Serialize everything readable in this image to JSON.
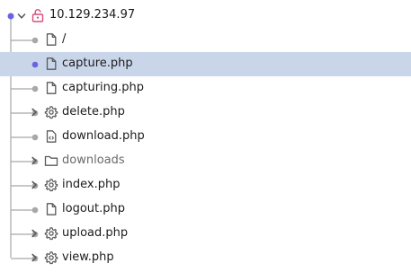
{
  "colors": {
    "selected_bg": "#c9d6ea",
    "root_lock": "#d94d7a",
    "active_dot": "#6b63e0",
    "tree_line": "#a8a8a8"
  },
  "root": {
    "label": "10.129.234.97",
    "icon": "unlocked-padlock-icon",
    "expanded": true
  },
  "items": [
    {
      "label": "/",
      "icon": "file-icon",
      "expandable": false,
      "selected": false
    },
    {
      "label": "capture.php",
      "icon": "file-icon",
      "expandable": false,
      "selected": true
    },
    {
      "label": "capturing.php",
      "icon": "file-icon",
      "expandable": false,
      "selected": false
    },
    {
      "label": "delete.php",
      "icon": "gear-icon",
      "expandable": true,
      "selected": false
    },
    {
      "label": "download.php",
      "icon": "code-file-icon",
      "expandable": false,
      "selected": false
    },
    {
      "label": "downloads",
      "icon": "folder-icon",
      "expandable": true,
      "selected": false
    },
    {
      "label": "index.php",
      "icon": "gear-icon",
      "expandable": true,
      "selected": false
    },
    {
      "label": "logout.php",
      "icon": "file-icon",
      "expandable": false,
      "selected": false
    },
    {
      "label": "upload.php",
      "icon": "gear-icon",
      "expandable": true,
      "selected": false
    },
    {
      "label": "view.php",
      "icon": "gear-icon",
      "expandable": true,
      "selected": false
    }
  ]
}
